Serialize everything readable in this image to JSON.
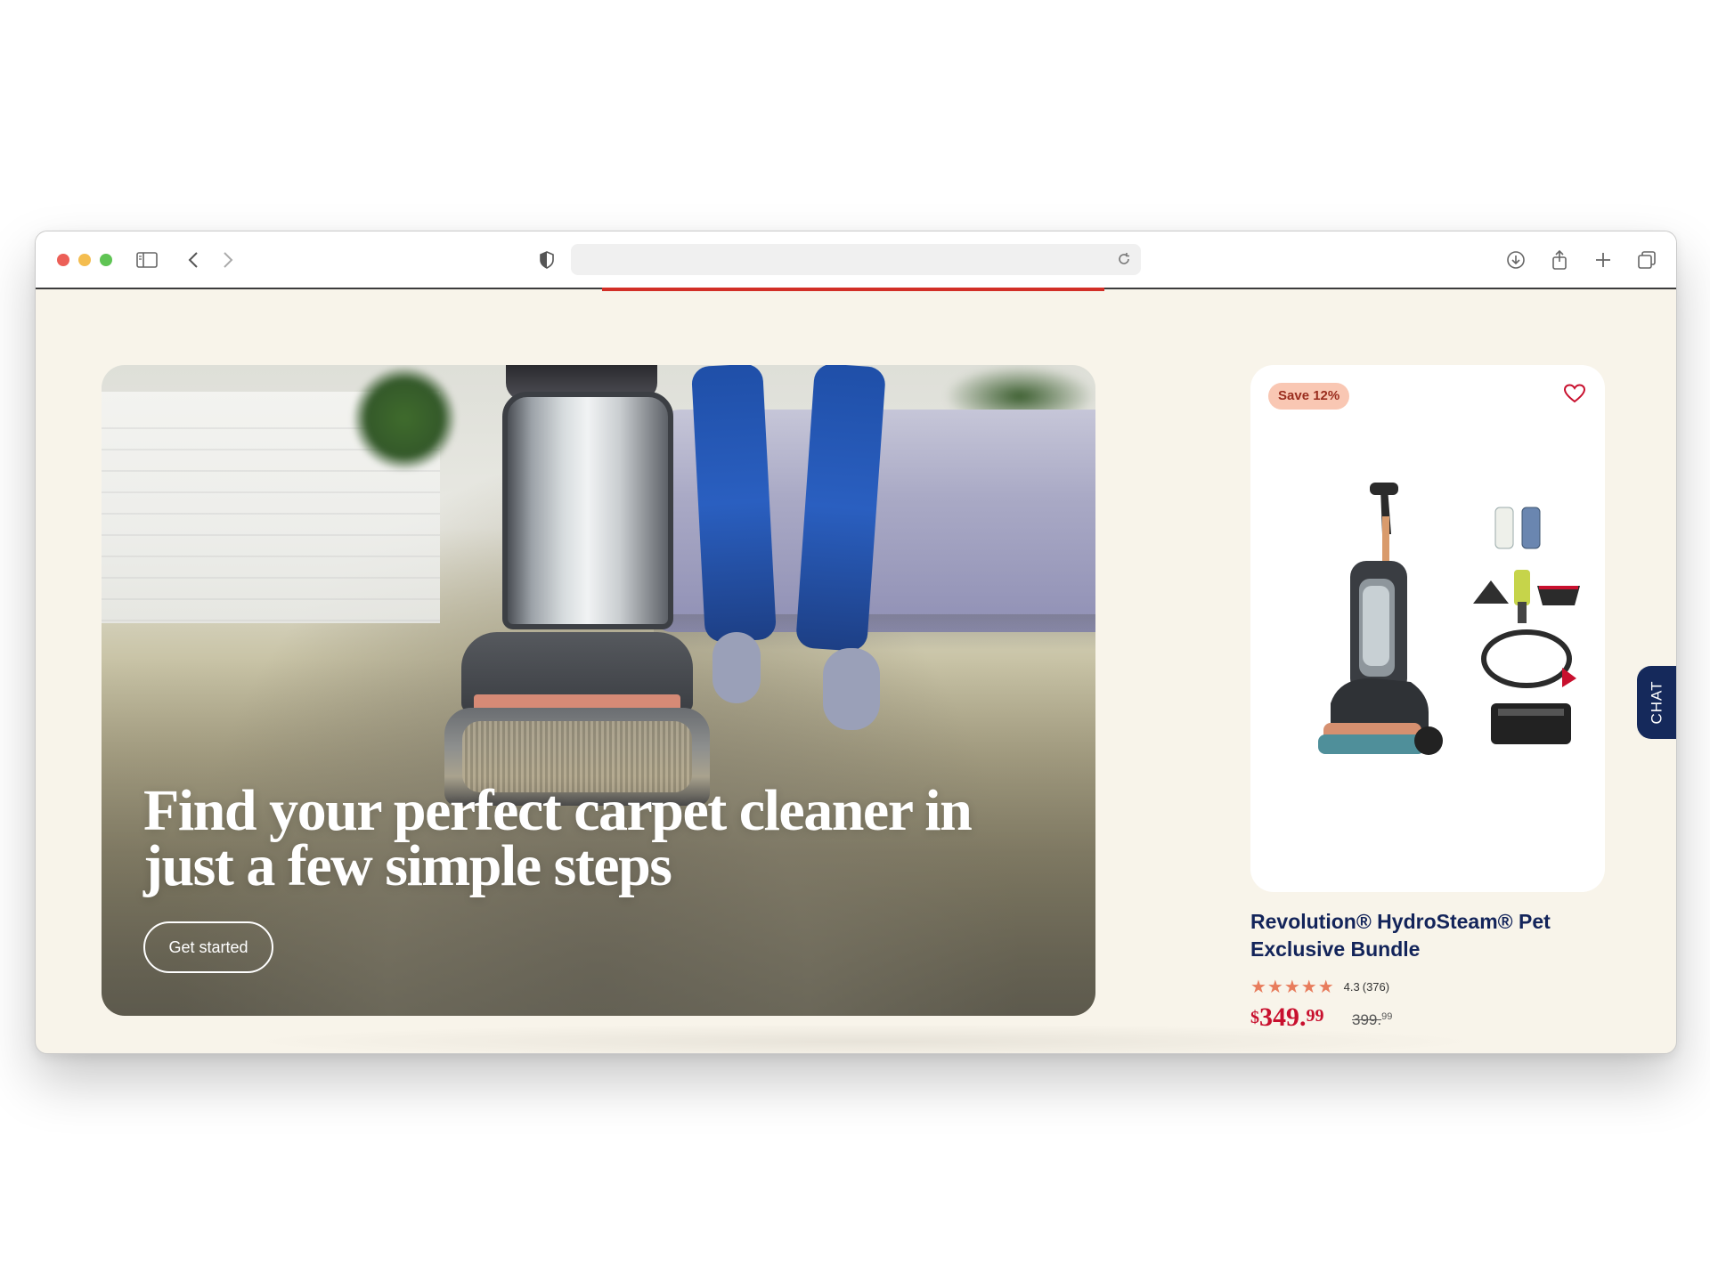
{
  "browser": {
    "url": "",
    "icons": [
      "sidebar-icon",
      "back-icon",
      "forward-icon",
      "shield-icon",
      "reload-icon",
      "download-icon",
      "share-icon",
      "new-tab-icon",
      "tabs-overview-icon"
    ]
  },
  "hero": {
    "title": "Find your perfect carpet cleaner in just a few simple steps",
    "button_label": "Get started"
  },
  "product": {
    "badge": "Save 12%",
    "title": "Revolution® HydroSteam® Pet Exclusive Bundle",
    "stars": "★★★★★",
    "rating": "4.3",
    "review_count": "(376)",
    "price_currency": "$",
    "price_main": "349.",
    "price_cents": "99",
    "was_main": "399.",
    "was_cents": "99"
  },
  "chat": {
    "label": "CHAT"
  },
  "colors": {
    "page_bg": "#f8f4ea",
    "accent_red": "#c8102e",
    "navy": "#13245a",
    "badge_bg": "#f9c7b3",
    "star": "#e87c5c"
  }
}
